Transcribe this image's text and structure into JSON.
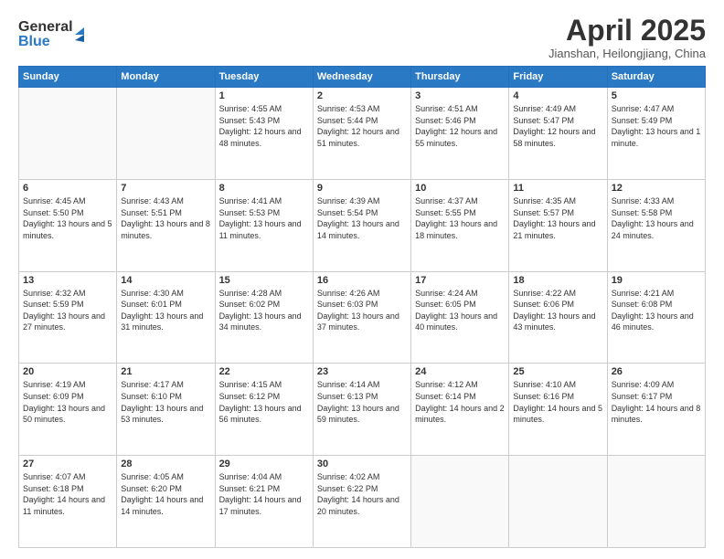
{
  "header": {
    "logo_line1": "General",
    "logo_line2": "Blue",
    "title": "April 2025",
    "subtitle": "Jianshan, Heilongjiang, China"
  },
  "calendar": {
    "weekdays": [
      "Sunday",
      "Monday",
      "Tuesday",
      "Wednesday",
      "Thursday",
      "Friday",
      "Saturday"
    ],
    "weeks": [
      [
        {
          "day": "",
          "info": ""
        },
        {
          "day": "",
          "info": ""
        },
        {
          "day": "1",
          "info": "Sunrise: 4:55 AM\nSunset: 5:43 PM\nDaylight: 12 hours\nand 48 minutes."
        },
        {
          "day": "2",
          "info": "Sunrise: 4:53 AM\nSunset: 5:44 PM\nDaylight: 12 hours\nand 51 minutes."
        },
        {
          "day": "3",
          "info": "Sunrise: 4:51 AM\nSunset: 5:46 PM\nDaylight: 12 hours\nand 55 minutes."
        },
        {
          "day": "4",
          "info": "Sunrise: 4:49 AM\nSunset: 5:47 PM\nDaylight: 12 hours\nand 58 minutes."
        },
        {
          "day": "5",
          "info": "Sunrise: 4:47 AM\nSunset: 5:49 PM\nDaylight: 13 hours\nand 1 minute."
        }
      ],
      [
        {
          "day": "6",
          "info": "Sunrise: 4:45 AM\nSunset: 5:50 PM\nDaylight: 13 hours\nand 5 minutes."
        },
        {
          "day": "7",
          "info": "Sunrise: 4:43 AM\nSunset: 5:51 PM\nDaylight: 13 hours\nand 8 minutes."
        },
        {
          "day": "8",
          "info": "Sunrise: 4:41 AM\nSunset: 5:53 PM\nDaylight: 13 hours\nand 11 minutes."
        },
        {
          "day": "9",
          "info": "Sunrise: 4:39 AM\nSunset: 5:54 PM\nDaylight: 13 hours\nand 14 minutes."
        },
        {
          "day": "10",
          "info": "Sunrise: 4:37 AM\nSunset: 5:55 PM\nDaylight: 13 hours\nand 18 minutes."
        },
        {
          "day": "11",
          "info": "Sunrise: 4:35 AM\nSunset: 5:57 PM\nDaylight: 13 hours\nand 21 minutes."
        },
        {
          "day": "12",
          "info": "Sunrise: 4:33 AM\nSunset: 5:58 PM\nDaylight: 13 hours\nand 24 minutes."
        }
      ],
      [
        {
          "day": "13",
          "info": "Sunrise: 4:32 AM\nSunset: 5:59 PM\nDaylight: 13 hours\nand 27 minutes."
        },
        {
          "day": "14",
          "info": "Sunrise: 4:30 AM\nSunset: 6:01 PM\nDaylight: 13 hours\nand 31 minutes."
        },
        {
          "day": "15",
          "info": "Sunrise: 4:28 AM\nSunset: 6:02 PM\nDaylight: 13 hours\nand 34 minutes."
        },
        {
          "day": "16",
          "info": "Sunrise: 4:26 AM\nSunset: 6:03 PM\nDaylight: 13 hours\nand 37 minutes."
        },
        {
          "day": "17",
          "info": "Sunrise: 4:24 AM\nSunset: 6:05 PM\nDaylight: 13 hours\nand 40 minutes."
        },
        {
          "day": "18",
          "info": "Sunrise: 4:22 AM\nSunset: 6:06 PM\nDaylight: 13 hours\nand 43 minutes."
        },
        {
          "day": "19",
          "info": "Sunrise: 4:21 AM\nSunset: 6:08 PM\nDaylight: 13 hours\nand 46 minutes."
        }
      ],
      [
        {
          "day": "20",
          "info": "Sunrise: 4:19 AM\nSunset: 6:09 PM\nDaylight: 13 hours\nand 50 minutes."
        },
        {
          "day": "21",
          "info": "Sunrise: 4:17 AM\nSunset: 6:10 PM\nDaylight: 13 hours\nand 53 minutes."
        },
        {
          "day": "22",
          "info": "Sunrise: 4:15 AM\nSunset: 6:12 PM\nDaylight: 13 hours\nand 56 minutes."
        },
        {
          "day": "23",
          "info": "Sunrise: 4:14 AM\nSunset: 6:13 PM\nDaylight: 13 hours\nand 59 minutes."
        },
        {
          "day": "24",
          "info": "Sunrise: 4:12 AM\nSunset: 6:14 PM\nDaylight: 14 hours\nand 2 minutes."
        },
        {
          "day": "25",
          "info": "Sunrise: 4:10 AM\nSunset: 6:16 PM\nDaylight: 14 hours\nand 5 minutes."
        },
        {
          "day": "26",
          "info": "Sunrise: 4:09 AM\nSunset: 6:17 PM\nDaylight: 14 hours\nand 8 minutes."
        }
      ],
      [
        {
          "day": "27",
          "info": "Sunrise: 4:07 AM\nSunset: 6:18 PM\nDaylight: 14 hours\nand 11 minutes."
        },
        {
          "day": "28",
          "info": "Sunrise: 4:05 AM\nSunset: 6:20 PM\nDaylight: 14 hours\nand 14 minutes."
        },
        {
          "day": "29",
          "info": "Sunrise: 4:04 AM\nSunset: 6:21 PM\nDaylight: 14 hours\nand 17 minutes."
        },
        {
          "day": "30",
          "info": "Sunrise: 4:02 AM\nSunset: 6:22 PM\nDaylight: 14 hours\nand 20 minutes."
        },
        {
          "day": "",
          "info": ""
        },
        {
          "day": "",
          "info": ""
        },
        {
          "day": "",
          "info": ""
        }
      ]
    ]
  }
}
